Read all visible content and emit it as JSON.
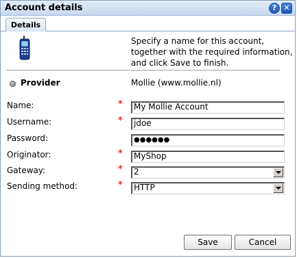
{
  "window": {
    "title": "Account details"
  },
  "titlebar": {
    "help_glyph": "?",
    "close_glyph": "✕"
  },
  "tabs": [
    {
      "label": "Details",
      "active": true
    }
  ],
  "instructions": "Specify a name for this account, together with the required information, and click Save to finish.",
  "provider": {
    "label": "Provider",
    "value": "Mollie (www.mollie.nl)"
  },
  "form": {
    "required_marker": "*",
    "fields": [
      {
        "label": "Name:",
        "value": "My Mollie Account",
        "required": true,
        "kind": "text"
      },
      {
        "label": "Username:",
        "value": "jdoe",
        "required": true,
        "kind": "text"
      },
      {
        "label": "Password:",
        "value": "●●●●●●",
        "required": false,
        "kind": "password"
      },
      {
        "label": "Originator:",
        "value": "MyShop",
        "required": true,
        "kind": "text"
      },
      {
        "label": "Gateway:",
        "value": "2",
        "required": true,
        "kind": "select"
      },
      {
        "label": "Sending method:",
        "value": "HTTP",
        "required": true,
        "kind": "select"
      }
    ]
  },
  "buttons": {
    "save": "Save",
    "cancel": "Cancel"
  },
  "colors": {
    "required": "#e03030",
    "titlebar": "#c6d8ef",
    "accent": "#1d53b0"
  },
  "icons": [
    "phone-icon",
    "help-icon",
    "close-icon",
    "provider-bullet-icon",
    "dropdown-arrow-icon"
  ]
}
